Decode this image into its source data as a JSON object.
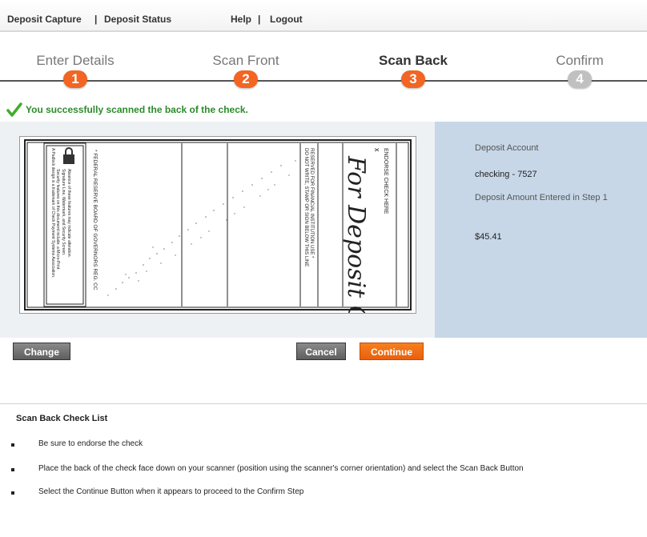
{
  "nav": {
    "deposit_capture": "Deposit Capture",
    "deposit_status": "Deposit Status",
    "help": "Help",
    "logout": "Logout",
    "separator": "|"
  },
  "steps": [
    {
      "label": "Enter Details",
      "number": "1",
      "state": "done"
    },
    {
      "label": "Scan Front",
      "number": "2",
      "state": "done"
    },
    {
      "label": "Scan Back",
      "number": "3",
      "state": "active"
    },
    {
      "label": "Confirm",
      "number": "4",
      "state": "pending"
    }
  ],
  "status_message": "You successfully scanned the back of the check.",
  "check_back": {
    "endorse_header": "ENDORSE CHECK HERE",
    "endorse_x": "x",
    "endorsement": "For Deposit Only",
    "do_not_write": "DO NOT WRITE, STAMP OR SIGN BELOW THIS LINE",
    "reserved": "RESERVED FOR FINANCIAL INSTITUTION USE *",
    "reserve_board": "* FEDERAL RESERVE BOARD OF GOVERNORS REG. CC",
    "security_1": "Security features on this document include: a Micro-Print",
    "security_2": "Signature Line, Watermark, and Security Screen.",
    "security_3": "Absence of these features may indicate alteration.",
    "security_4": "A Padlock design is a trademark of Check Payment Systems Association."
  },
  "info": {
    "account_label": "Deposit Account",
    "account_value": "checking - 7527",
    "amount_label": "Deposit Amount Entered in Step 1",
    "amount_value": "$45.41"
  },
  "buttons": {
    "change": "Change",
    "cancel": "Cancel",
    "continue": "Continue"
  },
  "checklist": {
    "title": "Scan Back Check List",
    "items": [
      "Be sure to endorse the check",
      "Place the back of the check face down on your scanner (position using the scanner's corner orientation) and select the Scan Back Button",
      "Select the Continue Button when it appears to proceed to the Confirm Step"
    ]
  },
  "colors": {
    "accent": "#f26522",
    "success": "#2c8b2c",
    "info_panel": "#c7d7e8",
    "check_panel": "#eef1f4"
  }
}
